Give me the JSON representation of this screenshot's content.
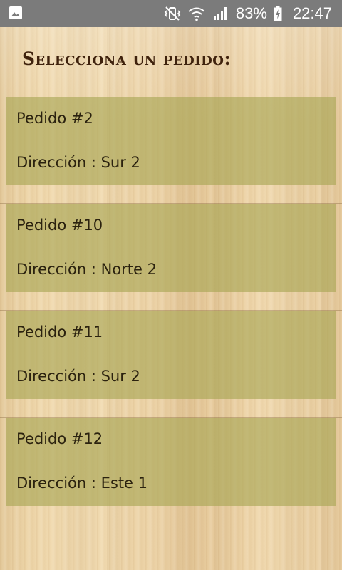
{
  "status_bar": {
    "icons": [
      "image-notification-icon",
      "vibrate-mute-icon",
      "wifi-icon",
      "signal-icon",
      "battery-charging-icon"
    ],
    "battery": "83%",
    "time": "22:47"
  },
  "page": {
    "title": "Selecciona un pedido:"
  },
  "orders": [
    {
      "id": "Pedido #2",
      "address": "Dirección : Sur 2"
    },
    {
      "id": "Pedido #10",
      "address": "Dirección : Norte 2"
    },
    {
      "id": "Pedido #11",
      "address": "Dirección : Sur 2"
    },
    {
      "id": "Pedido #12",
      "address": "Dirección : Este 1"
    }
  ],
  "colors": {
    "status_bar": "#7b7b7b",
    "card": "#a6a553",
    "title": "#3f220d",
    "text": "#2b220f"
  }
}
